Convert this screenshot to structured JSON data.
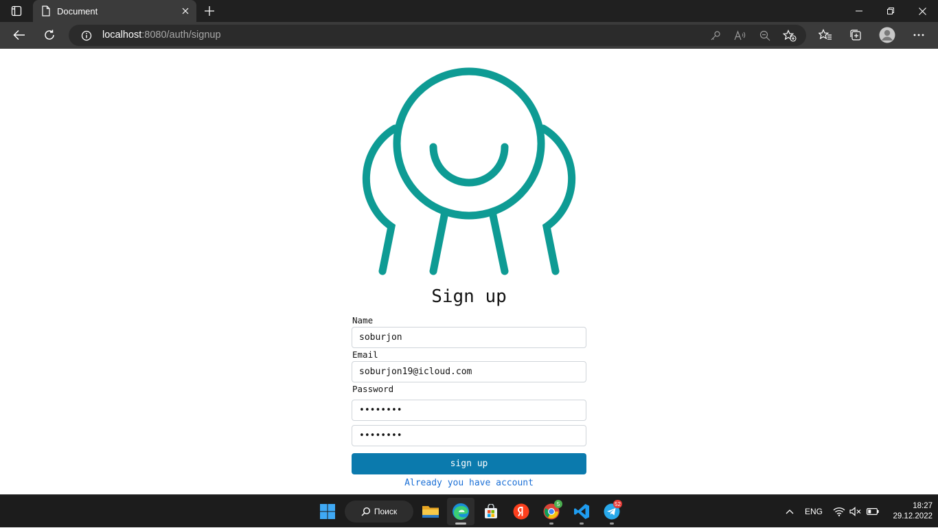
{
  "browser": {
    "tab_title": "Document",
    "url_host": "localhost",
    "url_rest": ":8080/auth/signup",
    "icons": [
      "tab-actions-icon",
      "page-icon",
      "close-icon",
      "plus-icon",
      "back-arrow-icon",
      "refresh-icon",
      "info-icon",
      "key-icon",
      "read-aloud-icon",
      "zoom-out-icon",
      "add-favorite-icon",
      "favorites-icon",
      "collections-icon",
      "profile-icon",
      "more-icon",
      "minimize-icon",
      "restore-icon",
      "close-window-icon"
    ]
  },
  "form": {
    "title": "Sign up",
    "name_label": "Name",
    "name_value": "soburjon",
    "email_label": "Email",
    "email_value": "soburjon19@icloud.com",
    "password_label": "Password",
    "password_value": "••••••••",
    "confirm_value": "••••••••",
    "submit_label": "sign up",
    "login_link": "Already you have account"
  },
  "colors": {
    "logo": "#0e9b94",
    "button": "#0b7aad",
    "link": "#1a6fd6"
  },
  "taskbar": {
    "search_label": "Поиск",
    "chrome_badge": "5",
    "telegram_badge": "52",
    "language": "ENG",
    "time": "18:27",
    "date": "29.12.2022"
  }
}
